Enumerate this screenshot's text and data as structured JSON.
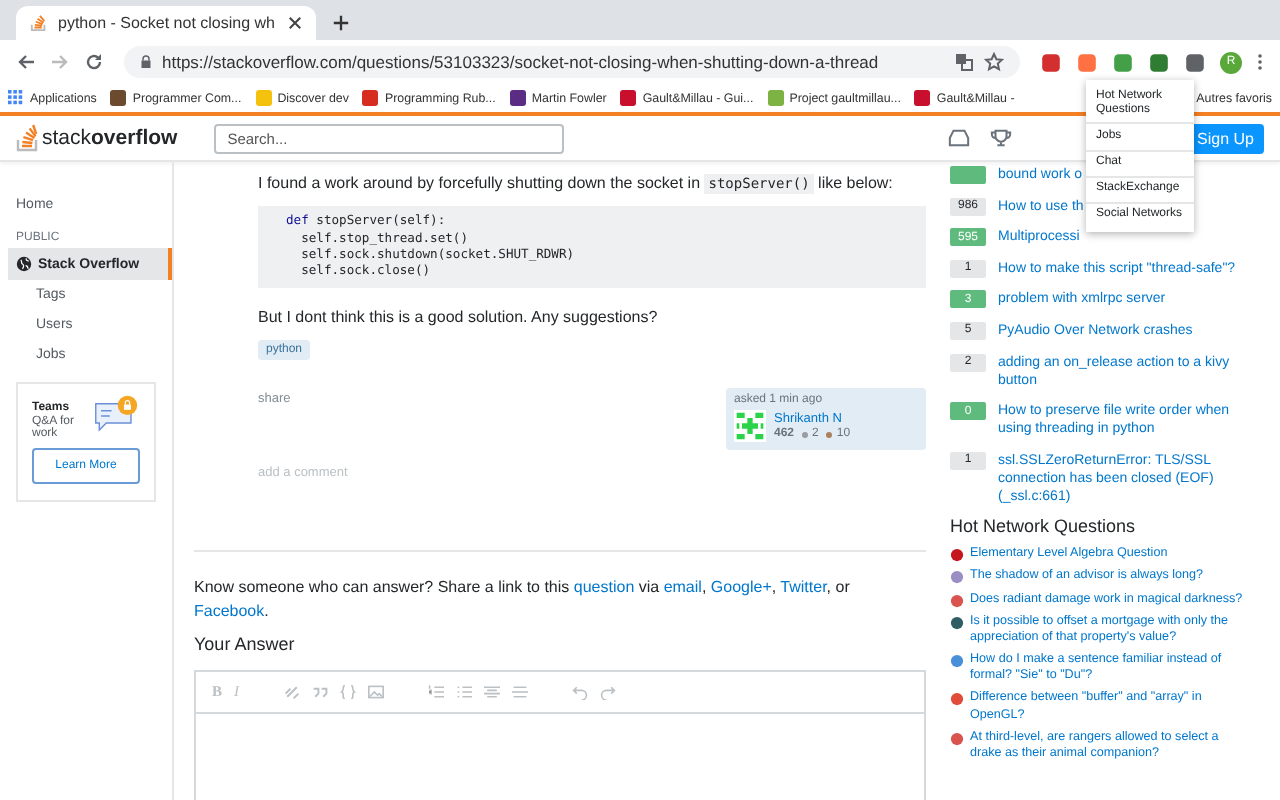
{
  "browser": {
    "tab": {
      "title": "python - Socket not closing wh"
    },
    "url": "https://stackoverflow.com/questions/53103323/socket-not-closing-when-shutting-down-a-thread",
    "profile": "R",
    "bookmarks": [
      {
        "label": "Applications",
        "kind": "apps"
      },
      {
        "label": "Programmer Com...",
        "kind": "site"
      },
      {
        "label": "Discover dev",
        "kind": "site"
      },
      {
        "label": "Programming Rub...",
        "kind": "site"
      },
      {
        "label": "Martin Fowler",
        "kind": "site"
      },
      {
        "label": "Gault&Millau - Gui...",
        "kind": "site"
      },
      {
        "label": "Project gaultmillau...",
        "kind": "site"
      },
      {
        "label": "Gault&Millau -",
        "kind": "site"
      },
      {
        "label": "Autres favoris",
        "kind": "plain"
      }
    ]
  },
  "header": {
    "logo": "stack**overflow**",
    "search": {
      "placeholder": "Search..."
    },
    "signup": "Sign Up"
  },
  "menu": [
    "Hot Network Questions",
    "Jobs",
    "Chat",
    "StackExchange",
    "Social Networks"
  ],
  "sidebar": {
    "items": [
      {
        "label": "Home",
        "kind": "item",
        "selected": false
      },
      {
        "label": "PUBLIC",
        "kind": "heading"
      },
      {
        "label": "Stack Overflow",
        "kind": "item",
        "selected": true
      },
      {
        "label": "Tags",
        "kind": "sub",
        "selected": false
      },
      {
        "label": "Users",
        "kind": "sub",
        "selected": false
      },
      {
        "label": "Jobs",
        "kind": "sub",
        "selected": false
      }
    ],
    "teams": {
      "title": "Teams",
      "subtitle": "Q&A for work",
      "button": "Learn More"
    }
  },
  "question": {
    "intro": [
      {
        "kind": "text",
        "text": "I found a work around by forcefully shutting down the socket in "
      },
      {
        "kind": "code",
        "text": "stopServer()"
      },
      {
        "kind": "text",
        "text": " like below:"
      }
    ],
    "code": [
      {
        "kind": "kw",
        "text": "def",
        "rest": " stopServer(self):"
      },
      {
        "kind": "plain",
        "text": "  self.stop_thread.set()"
      },
      {
        "kind": "plain",
        "text": "  self.sock.shutdown(socket.SHUT_RDWR)"
      },
      {
        "kind": "plain",
        "text": "  self.sock.close()"
      }
    ],
    "outro": "But I dont think this is a good solution. Any suggestions?",
    "tags": [
      "python"
    ],
    "share": "share",
    "asked": "asked 1 min ago",
    "user": {
      "name": "Shrikanth N",
      "reputation": "462",
      "badges": [
        {
          "count": "2",
          "color": "#9a9c9f"
        },
        {
          "count": "10",
          "color": "#ab825f"
        }
      ]
    },
    "add_comment": "add a comment"
  },
  "share_prompt": [
    {
      "kind": "text",
      "text": "Know someone who can answer? Share a link to this "
    },
    {
      "kind": "link",
      "text": "question"
    },
    {
      "kind": "text",
      "text": " via "
    },
    {
      "kind": "link",
      "text": "email"
    },
    {
      "kind": "text",
      "text": ", "
    },
    {
      "kind": "link",
      "text": "Google+"
    },
    {
      "kind": "text",
      "text": ", "
    },
    {
      "kind": "link",
      "text": "Twitter"
    },
    {
      "kind": "text",
      "text": ", or "
    },
    {
      "kind": "link",
      "text": "Facebook"
    },
    {
      "kind": "text",
      "text": "."
    }
  ],
  "answer": {
    "heading": "Your Answer",
    "toolbar": [
      "B",
      "I"
    ]
  },
  "related": [
    {
      "title": "bound work o",
      "accepted": true
    },
    {
      "count": "986",
      "title": "How to use th",
      "accepted": false
    },
    {
      "count": "595",
      "title": "Multiprocessi",
      "accepted": true
    },
    {
      "count": "1",
      "title": "How to make this script \"thread-safe\"?",
      "accepted": false
    },
    {
      "count": "3",
      "title": "problem with xmlrpc server",
      "accepted": true
    },
    {
      "count": "5",
      "title": "PyAudio Over Network crashes",
      "accepted": false
    },
    {
      "count": "2",
      "title": "adding an on_release action to a kivy button",
      "accepted": false
    },
    {
      "count": "0",
      "title": "How to preserve file write order when using threading in python",
      "accepted": true
    },
    {
      "count": "1",
      "title": "ssl.SSLZeroReturnError: TLS/SSL connection has been closed (EOF) (_ssl.c:661)",
      "accepted": false
    }
  ],
  "hot": {
    "title": "Hot Network Questions",
    "items": [
      {
        "title": "Elementary Level Algebra Question",
        "color": "#c4161c"
      },
      {
        "title": "The shadow of an advisor is always long?",
        "color": "#9b8ec4"
      },
      {
        "title": "Does radiant damage work in magical darkness?",
        "color": "#d9534f"
      },
      {
        "title": "Is it possible to offset a mortgage with only the appreciation of that property's value?",
        "color": "#2e5d63"
      },
      {
        "title": "How do I make a sentence familiar instead of formal? \"Sie\" to \"Du\"?",
        "color": "#4a90d9"
      },
      {
        "title": "Difference between \"buffer\" and \"array\" in OpenGL?",
        "color": "#e04b3a"
      },
      {
        "title": "At third-level, are rangers allowed to select a drake as their animal companion?",
        "color": "#d9534f"
      }
    ]
  }
}
